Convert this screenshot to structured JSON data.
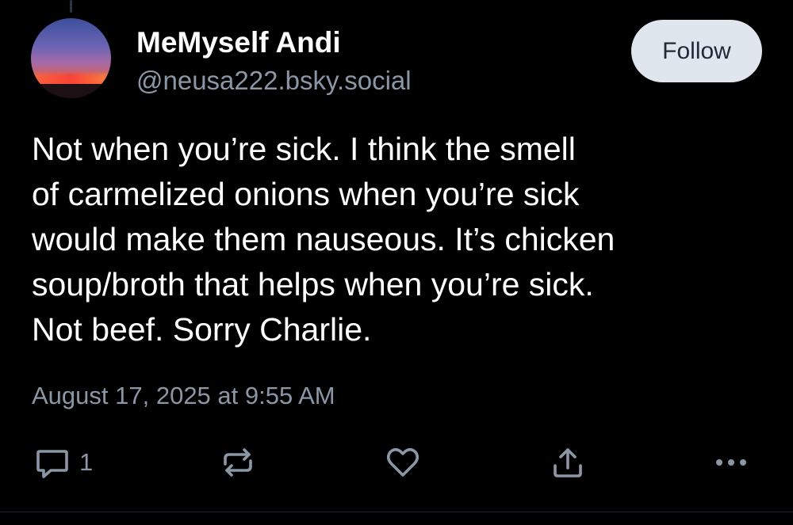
{
  "post": {
    "author": {
      "display_name": "MeMyself Andi",
      "handle": "@neusa222.bsky.social"
    },
    "follow_label": "Follow",
    "text_lines": [
      "Not when you’re sick. I think the smell",
      "of carmelized onions when you’re sick",
      "would make them nauseous. It’s chicken",
      "soup/broth that helps when you’re sick.",
      "Not beef. Sorry Charlie."
    ],
    "timestamp": "August 17, 2025 at 9:55 AM",
    "actions": {
      "reply_count": "1",
      "icons": [
        "reply-icon",
        "repost-icon",
        "like-icon",
        "share-icon",
        "more-icon"
      ]
    }
  },
  "colors": {
    "background": "#000000",
    "text": "#ffffff",
    "muted": "#8b97a6",
    "follow_button_bg": "#dfe6ee"
  }
}
